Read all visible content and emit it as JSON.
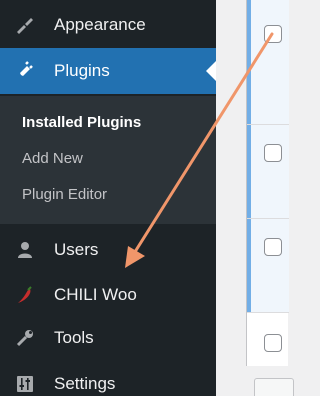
{
  "sidebar": {
    "items": {
      "appearance": {
        "label": "Appearance",
        "icon": "paintbrush-icon"
      },
      "plugins": {
        "label": "Plugins",
        "icon": "plugin-icon"
      },
      "users": {
        "label": "Users",
        "icon": "user-icon"
      },
      "chili": {
        "label": "CHILI Woo",
        "icon": "chili-pepper-icon"
      },
      "tools": {
        "label": "Tools",
        "icon": "wrench-icon"
      },
      "settings": {
        "label": "Settings",
        "icon": "sliders-icon"
      }
    },
    "submenu": {
      "installed": "Installed Plugins",
      "add_new": "Add New",
      "editor": "Plugin Editor"
    }
  },
  "colors": {
    "sidebar_bg": "#1d2327",
    "active_bg": "#2271b1",
    "annotation_arrow": "#f0966a"
  }
}
